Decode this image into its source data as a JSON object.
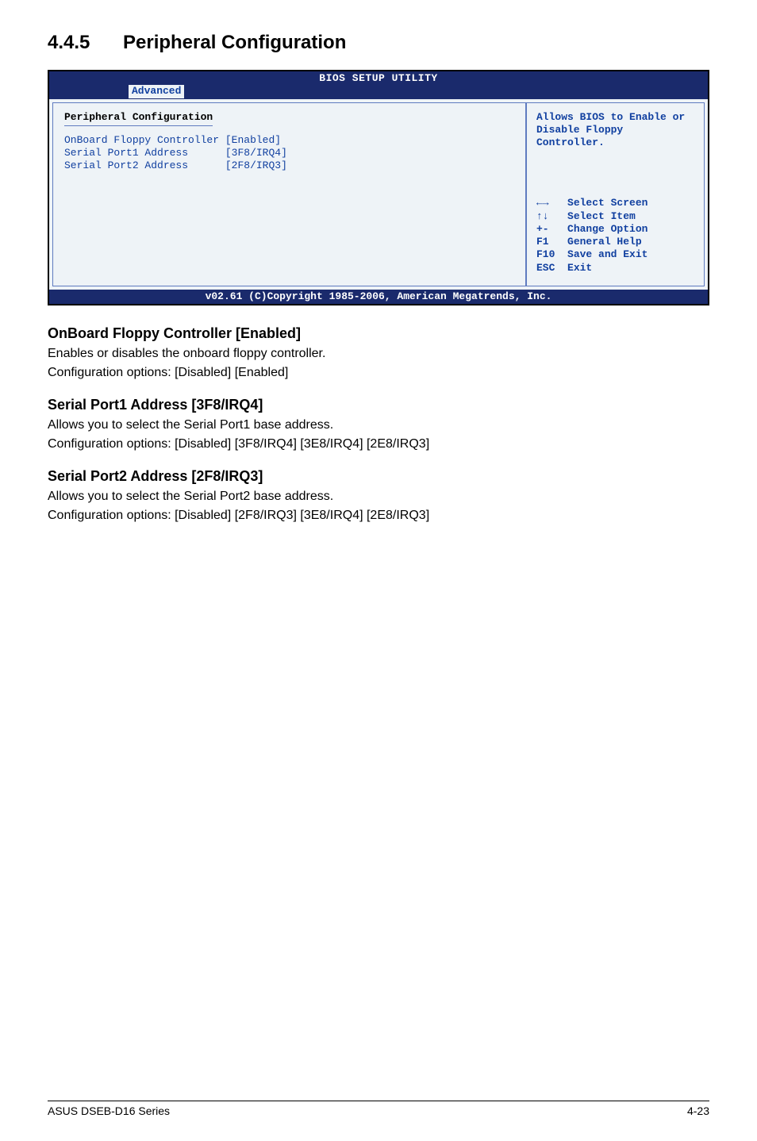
{
  "section": {
    "number": "4.4.5",
    "title": "Peripheral Configuration"
  },
  "bios": {
    "header_title": "BIOS SETUP UTILITY",
    "active_tab": "Advanced",
    "left": {
      "heading": "Peripheral Configuration",
      "rows": [
        {
          "label": "OnBoard Floppy Controller",
          "value": "[Enabled]"
        },
        {
          "label": "Serial Port1 Address     ",
          "value": "[3F8/IRQ4]"
        },
        {
          "label": "Serial Port2 Address     ",
          "value": "[2F8/IRQ3]"
        }
      ]
    },
    "right": {
      "help_text": "Allows BIOS to Enable or Disable Floppy Controller.",
      "keys": [
        {
          "key": "←→ ",
          "desc": "Select Screen"
        },
        {
          "key": "↑↓ ",
          "desc": "Select Item"
        },
        {
          "key": "+- ",
          "desc": "Change Option"
        },
        {
          "key": "F1 ",
          "desc": "General Help"
        },
        {
          "key": "F10",
          "desc": "Save and Exit"
        },
        {
          "key": "ESC",
          "desc": "Exit"
        }
      ]
    },
    "footer": "v02.61 (C)Copyright 1985-2006, American Megatrends, Inc."
  },
  "items": [
    {
      "heading": "OnBoard Floppy Controller [Enabled]",
      "line1": "Enables or disables the onboard floppy controller.",
      "line2": "Configuration options: [Disabled] [Enabled]"
    },
    {
      "heading": "Serial Port1 Address [3F8/IRQ4]",
      "line1": "Allows you to select the Serial Port1 base address.",
      "line2": "Configuration options: [Disabled] [3F8/IRQ4] [3E8/IRQ4] [2E8/IRQ3]"
    },
    {
      "heading": "Serial Port2 Address [2F8/IRQ3]",
      "line1": "Allows you to select the Serial Port2 base address.",
      "line2": "Configuration options: [Disabled] [2F8/IRQ3] [3E8/IRQ4] [2E8/IRQ3]"
    }
  ],
  "footer": {
    "left": "ASUS DSEB-D16 Series",
    "right": "4-23"
  }
}
